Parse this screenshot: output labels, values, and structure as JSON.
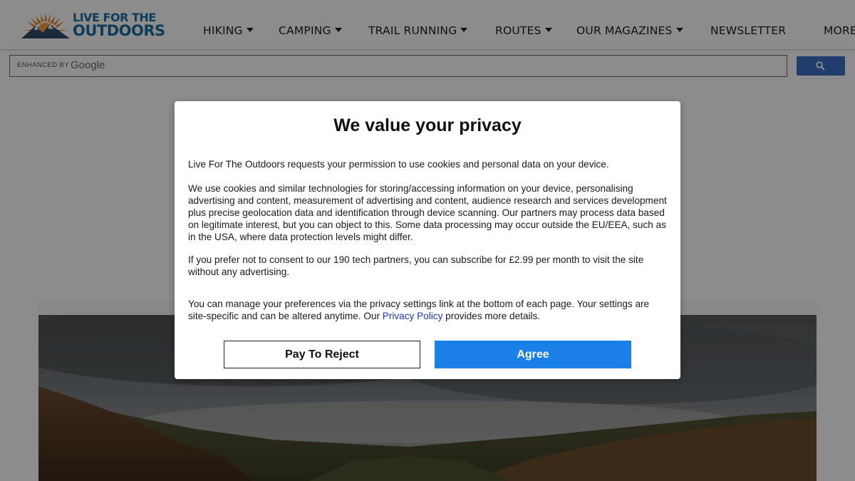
{
  "header": {
    "logo": {
      "line1": "LIVE FOR THE",
      "line2": "OUTDOORS"
    },
    "nav": [
      {
        "label": "HIKING",
        "dropdown": true
      },
      {
        "label": "CAMPING",
        "dropdown": true
      },
      {
        "label": "TRAIL RUNNING",
        "dropdown": true
      },
      {
        "label": "ROUTES",
        "dropdown": true
      },
      {
        "label": "OUR MAGAZINES",
        "dropdown": true
      },
      {
        "label": "NEWSLETTER",
        "dropdown": false
      },
      {
        "label": "MORE",
        "dropdown": false
      }
    ]
  },
  "search": {
    "enhanced_by": "ENHANCED BY",
    "provider": "Google",
    "button_icon": "search-icon"
  },
  "modal": {
    "title": "We value your privacy",
    "p1": "Live For The Outdoors requests your permission to use cookies and personal data on your device.",
    "p2": "We use cookies and similar technologies for storing/accessing information on your device, personalising advertising and content, measurement of advertising and content, audience research and services development plus precise geolocation data and identification through device scanning. Our partners may process data based on legitimate interest, but you can object to this. Some data processing may occur outside the EU/EEA, such as in the USA, where data protection levels might differ.",
    "p3": "If you prefer not to consent to our 190 tech partners, you can subscribe for £2.99 per month to visit the site without any advertising.",
    "p4_before": "You can manage your preferences via the privacy settings link at the bottom of each page. Your settings are site-specific and can be altered anytime. Our ",
    "p4_link": "Privacy Policy",
    "p4_after": " provides more details.",
    "reject_label": "Pay To Reject",
    "agree_label": "Agree"
  },
  "colors": {
    "brand": "#1b6ea3",
    "agree": "#1a7fe6",
    "search_button": "#3b6fc8",
    "link": "#1a35c8"
  }
}
